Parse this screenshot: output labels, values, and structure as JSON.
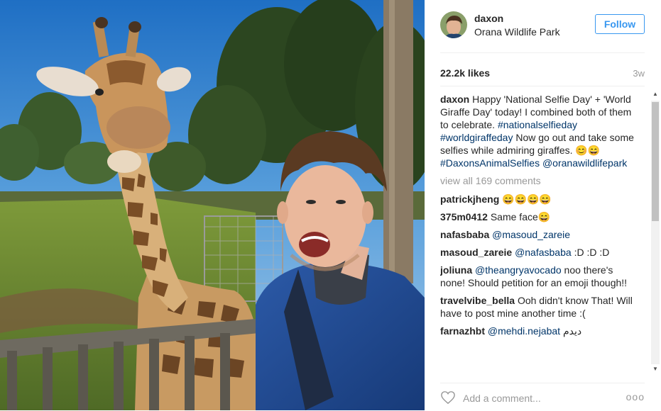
{
  "post": {
    "username": "daxon",
    "location": "Orana Wildlife Park",
    "follow_label": "Follow",
    "likes": "22.2k likes",
    "age": "3w"
  },
  "caption": {
    "username": "daxon",
    "text_1": "Happy 'National Selfie Day' + 'World Giraffe Day' today! I combined both of them to celebrate.",
    "hashtag_1": "#nationalselfieday",
    "hashtag_2": "#worldgiraffeday",
    "text_2": "Now go out and take some selfies while admiring giraffes. 😊😄",
    "hashtag_3": "#DaxonsAnimalSelfies",
    "mention": "@oranawildlifepark"
  },
  "view_all": "view all 169 comments",
  "comments": [
    {
      "user": "patrickjheng",
      "mention": "",
      "text": "😄😄😄😄"
    },
    {
      "user": "375m0412",
      "mention": "",
      "text": "Same face😄"
    },
    {
      "user": "nafasbaba",
      "mention": "@masoud_zareie",
      "text": ""
    },
    {
      "user": "masoud_zareie",
      "mention": "@nafasbaba",
      "text": ":D :D :D"
    },
    {
      "user": "joliuna",
      "mention": "@theangryavocado",
      "text": "noo there's none! Should petition for an emoji though!!"
    },
    {
      "user": "travelvibe_bella",
      "mention": "",
      "text": "Ooh didn't know That! Will have to post mine another time :("
    },
    {
      "user": "farnazhbt",
      "mention": "@mehdi.nejabat",
      "text": "دیدم"
    }
  ],
  "footer": {
    "add_comment_placeholder": "Add a comment...",
    "more_label": "ooo"
  },
  "icons": {
    "like": "heart-icon",
    "more": "more-options-icon"
  },
  "colors": {
    "accent": "#3897f0",
    "link": "#003569",
    "muted": "#999999"
  }
}
